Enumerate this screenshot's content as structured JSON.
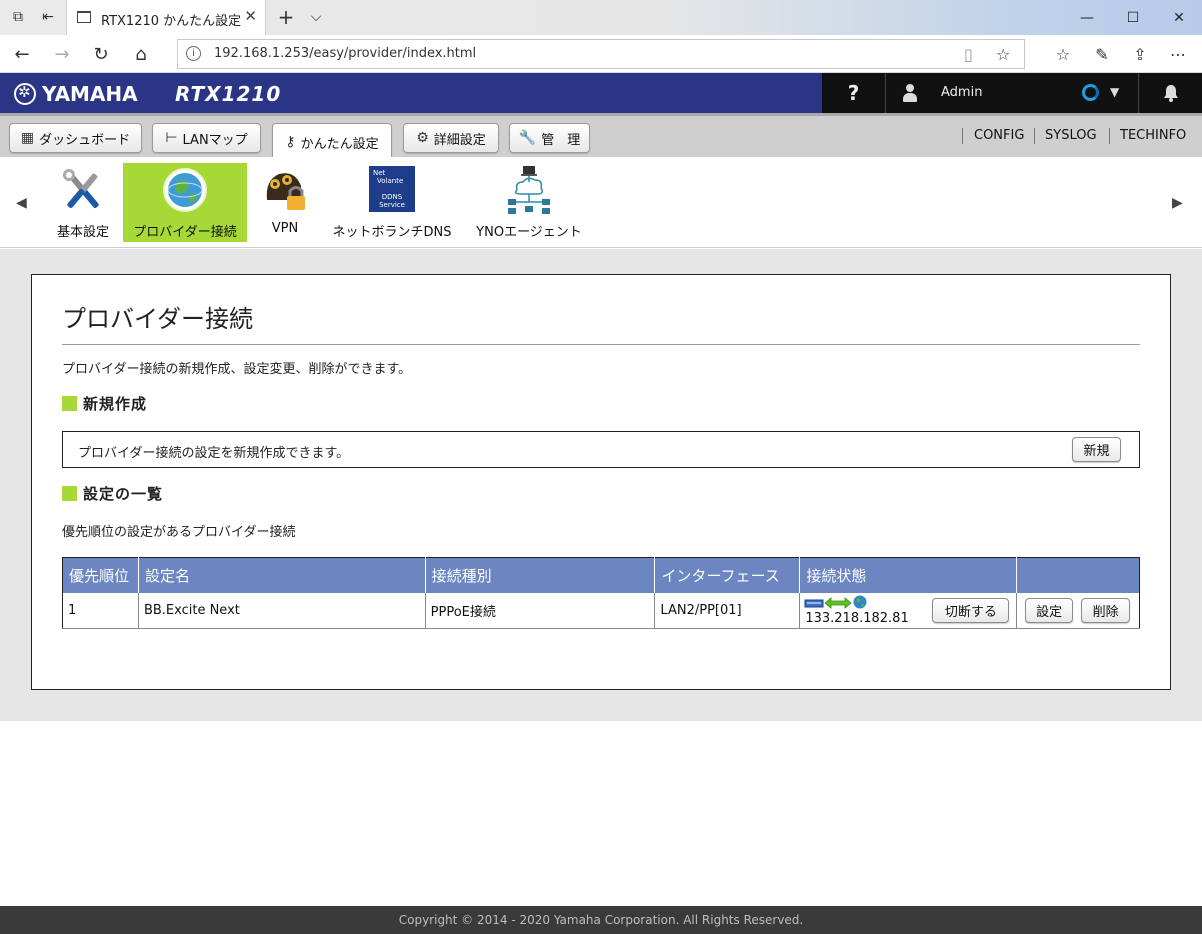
{
  "browser": {
    "tab_title": "RTX1210 かんたん設定 - ",
    "tab_close": "✕",
    "new_tab": "+",
    "tab_list": "⌵",
    "url": "192.168.1.253/easy/provider/index.html",
    "window_controls": {
      "minimize": "—",
      "maximize": "☐",
      "close": "✕"
    }
  },
  "header": {
    "brand": "YAMAHA",
    "model": "RTX1210",
    "help": "?",
    "user": "Admin",
    "status_caret": "▼"
  },
  "menu": {
    "dashboard": "ダッシュボード",
    "lanmap": "LANマップ",
    "easy": "かんたん設定",
    "advanced": "詳細設定",
    "manage": "管　理",
    "links": [
      "CONFIG",
      "SYSLOG",
      "TECHINFO"
    ]
  },
  "submenu": {
    "prev": "◀",
    "next": "▶",
    "items": [
      "基本設定",
      "プロバイダー接続",
      "VPN",
      "ネットボランチDNS",
      "YNOエージェント"
    ],
    "ddns_icon_text": [
      "Net",
      "Volante",
      "DDNS",
      "Service"
    ]
  },
  "page": {
    "title": "プロバイダー接続",
    "description": "プロバイダー接続の新規作成、設定変更、削除ができます。",
    "new_section": {
      "heading": "新規作成",
      "text": "プロバイダー接続の設定を新規作成できます。",
      "button": "新規"
    },
    "list_section": {
      "heading": "設定の一覧",
      "description": "優先順位の設定があるプロバイダー接続",
      "columns": [
        "優先順位",
        "設定名",
        "接続種別",
        "インターフェース",
        "接続状態",
        ""
      ],
      "rows": [
        {
          "priority": "1",
          "name": "BB.Excite Next",
          "type": "PPPoE接続",
          "interface": "LAN2/PP[01]",
          "ip": "133.218.182.81",
          "disconnect": "切断する",
          "edit": "設定",
          "delete": "削除"
        }
      ]
    }
  },
  "footer": "Copyright © 2014 - 2020 Yamaha Corporation. All Rights Reserved.",
  "colors": {
    "header_bg": "#2a3685",
    "accent_green": "#a6d836",
    "table_header": "#6b86c1"
  }
}
